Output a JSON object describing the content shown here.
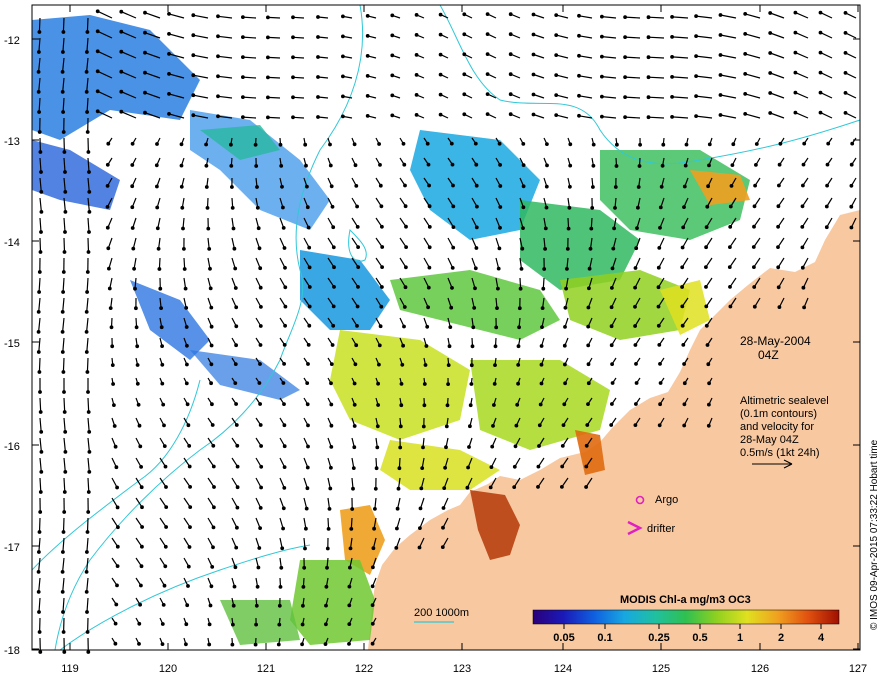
{
  "map": {
    "date_line1": "28-May-2004",
    "date_line2": "04Z",
    "lon_ticks": [
      "119",
      "120",
      "121",
      "122",
      "123",
      "124",
      "125",
      "126",
      "127"
    ],
    "lat_ticks": [
      "-12",
      "-13",
      "-14",
      "-15",
      "-16",
      "-17",
      "-18"
    ],
    "altimetry": {
      "line1": "Altimetric sealevel",
      "line2": "(0.1m contours)",
      "line3": "and velocity for",
      "line4": "28-May 04Z",
      "line5": "0.5m/s (1kt 24h)"
    },
    "legend": {
      "argo_label": "Argo",
      "drifter_label": "drifter",
      "argo_color": "#e020c0",
      "drifter_color": "#e020c0"
    },
    "bathymetry_label": "200  1000m",
    "bathymetry_color": "#30c8d8",
    "land_color": "#f8c8a0"
  },
  "colorbar": {
    "title": "MODIS Chl-a mg/m3 OC3",
    "tick_labels": [
      "0.05",
      "0.1",
      "0.25",
      "0.5",
      "1",
      "2",
      "4"
    ],
    "colors": [
      "#2a007a",
      "#1a1ab8",
      "#1060e0",
      "#18a8e0",
      "#20c0a0",
      "#30c050",
      "#90d020",
      "#e0e020",
      "#f0a020",
      "#e05010",
      "#a01000"
    ]
  },
  "credit": "© IMOS 09-Apr-2015 07:33:22 Hobart time"
}
